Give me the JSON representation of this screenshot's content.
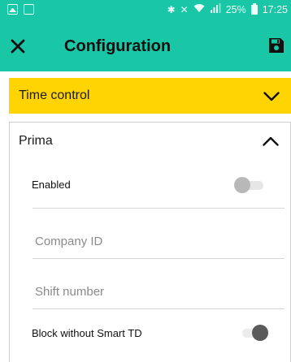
{
  "status_bar": {
    "battery_percent": "25%",
    "time": "17:25",
    "icons": [
      "image-notification-icon",
      "app-notification-icon",
      "bluetooth-icon",
      "mute-icon",
      "wifi-icon",
      "signal-icon",
      "battery-icon"
    ]
  },
  "toolbar": {
    "title": "Configuration",
    "close_icon": "close-icon",
    "save_icon": "save-icon"
  },
  "time_control": {
    "label": "Time control",
    "icon": "chevron-down-icon",
    "color": "#FFD400"
  },
  "prima": {
    "title": "Prima",
    "icon": "chevron-up-icon",
    "enabled_label": "Enabled",
    "enabled_on": false,
    "company_id_placeholder": "Company ID",
    "company_id_value": "",
    "shift_number_placeholder": "Shift number",
    "shift_number_value": "",
    "block_label": "Block without Smart TD",
    "block_on": false
  },
  "colors": {
    "accent": "#19C7A6",
    "section": "#FFD400"
  }
}
